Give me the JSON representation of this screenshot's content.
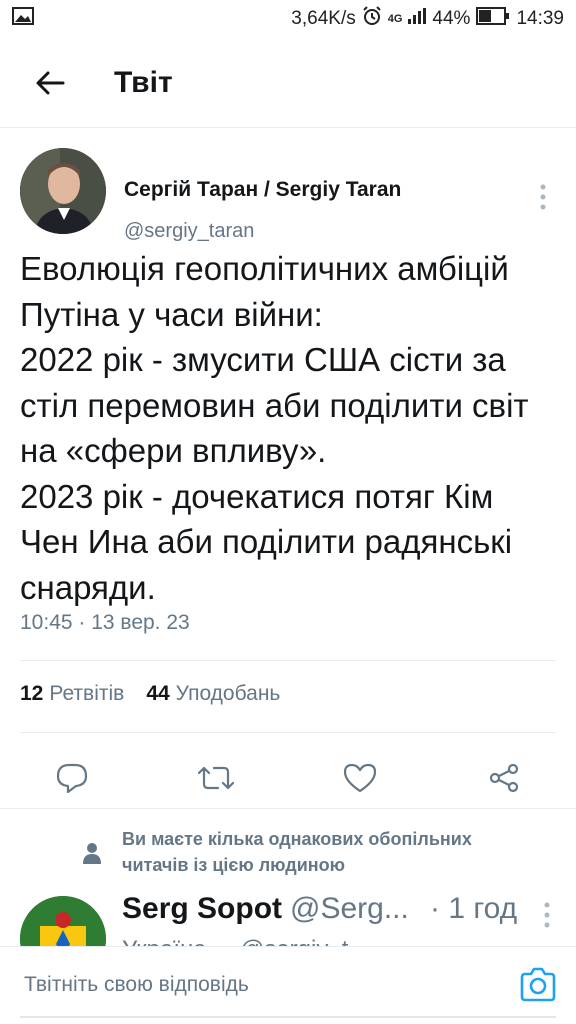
{
  "statusbar": {
    "speed": "3,64K/s",
    "network": "4G",
    "battery": "44%",
    "time": "14:39"
  },
  "header": {
    "title": "Твіт"
  },
  "tweet": {
    "author_name": "Сергій Таран / Sergiy Taran",
    "author_handle": "@sergiy_taran",
    "text": "Еволюція геополітичних амбіцій Путіна у часи війни:\n2022 рік - змусити США сісти за стіл перемовин аби поділити світ на «сфери впливу».\n2023 рік - дочекатися потяг Кім Чен Ина аби поділити радянські снаряди.",
    "timestamp": "10:45 · 13 вер. 23",
    "retweets_count": "12",
    "retweets_label": "Ретвітів",
    "likes_count": "44",
    "likes_label": "Уподобань"
  },
  "mutual": {
    "text": "Ви маєте кілька однакових обопільних читачів із цією людиною"
  },
  "reply": {
    "name": "Serg Sopot",
    "handle": "@Serg...",
    "time": "· 1 год",
    "peek": "Україна ... @sergiy_t..."
  },
  "composer": {
    "placeholder": "Твітніть свою відповідь"
  },
  "colors": {
    "accent": "#1da1f2",
    "muted": "#657786",
    "text": "#14171a"
  }
}
